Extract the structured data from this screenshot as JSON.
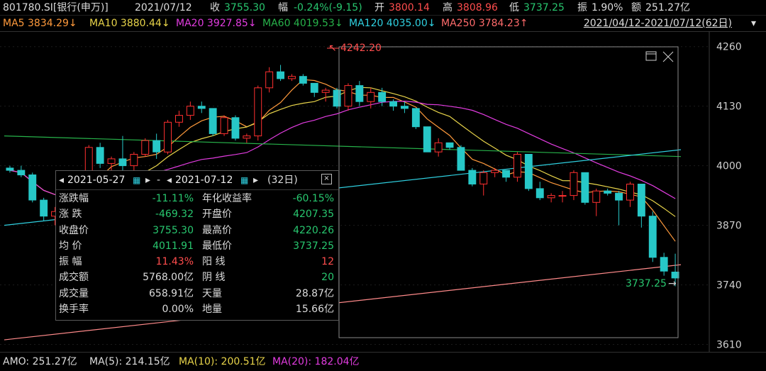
{
  "header": {
    "code": "801780.SI[银行(申万)]",
    "date": "2021/07/12",
    "close_label": "收",
    "close": "3755.30",
    "change_label": "幅",
    "change": "-0.24%(-9.15)",
    "open_label": "开",
    "open": "3800.14",
    "high_label": "高",
    "high": "3808.96",
    "low_label": "低",
    "low": "3737.25",
    "amp_label": "振",
    "amp": "1.90%",
    "amount_label": "额",
    "amount": "251.27亿"
  },
  "ma_bar": {
    "ma5": "MA5 3834.29↓",
    "ma10": "MA10 3880.44↓",
    "ma20": "MA20 3927.85↓",
    "ma60": "MA60 4019.53↓",
    "ma120": "MA120 4035.00↓",
    "ma250": "MA250 3784.23↑",
    "period": "2021/04/12-2021/07/12(62日)"
  },
  "bottom_bar": {
    "amo": "AMO: 251.27亿",
    "ma5": "MA(5): 214.15亿",
    "ma10": "MA(10): 200.51亿",
    "ma20": "MA(20): 182.04亿"
  },
  "popup": {
    "start": "2021-05-27",
    "dash": "-",
    "end": "2021-07-12",
    "days": "(32日)",
    "rows": [
      {
        "l1": "涨跌幅",
        "v1": "-11.11%",
        "l2": "年化收益率",
        "v2": "-60.15%",
        "c1": "g",
        "c2": "g"
      },
      {
        "l1": "涨 跌",
        "v1": "-469.32",
        "l2": "开盘价",
        "v2": "4207.35",
        "c1": "g",
        "c2": "g"
      },
      {
        "l1": "收盘价",
        "v1": "3755.30",
        "l2": "最高价",
        "v2": "4220.26",
        "c1": "g",
        "c2": "g"
      },
      {
        "l1": "均 价",
        "v1": "4011.91",
        "l2": "最低价",
        "v2": "3737.25",
        "c1": "g",
        "c2": "g"
      },
      {
        "l1": "振 幅",
        "v1": "11.43%",
        "l2": "阳 线",
        "v2": "12",
        "c1": "r",
        "c2": "r"
      },
      {
        "l1": "成交额",
        "v1": "5768.00亿",
        "l2": "阴 线",
        "v2": "20",
        "c1": "w",
        "c2": "g"
      },
      {
        "l1": "成交量",
        "v1": "658.91亿",
        "l2": "天量",
        "v2": "28.87亿",
        "c1": "w",
        "c2": "w"
      },
      {
        "l1": "换手率",
        "v1": "0.00%",
        "l2": "地量",
        "v2": "15.66亿",
        "c1": "w",
        "c2": "w"
      }
    ]
  },
  "chart_data": {
    "type": "candlestick",
    "ylim": [
      3600,
      4275
    ],
    "y_ticks": [
      "4260",
      "4130",
      "4000",
      "3870",
      "3740",
      "3610"
    ],
    "annotations": {
      "high": "4242.20",
      "low": "3737.25"
    },
    "candles": [
      [
        3995,
        4000,
        3985,
        3990
      ],
      [
        3990,
        4000,
        3975,
        3980
      ],
      [
        3980,
        3985,
        3920,
        3925
      ],
      [
        3925,
        3930,
        3880,
        3890
      ],
      [
        3890,
        3910,
        3870,
        3900
      ],
      [
        3900,
        3955,
        3895,
        3950
      ],
      [
        3950,
        3985,
        3945,
        3980
      ],
      [
        3980,
        4045,
        3975,
        4040
      ],
      [
        4040,
        4050,
        3995,
        4005
      ],
      [
        4005,
        4020,
        3975,
        4015
      ],
      [
        4015,
        4065,
        3985,
        4000
      ],
      [
        4000,
        4030,
        3990,
        4025
      ],
      [
        4025,
        4060,
        4020,
        4055
      ],
      [
        4055,
        4070,
        4015,
        4030
      ],
      [
        4030,
        4100,
        4025,
        4095
      ],
      [
        4095,
        4120,
        4085,
        4110
      ],
      [
        4110,
        4140,
        4100,
        4130
      ],
      [
        4130,
        4140,
        4115,
        4125
      ],
      [
        4125,
        4125,
        4065,
        4070
      ],
      [
        4070,
        4110,
        4065,
        4105
      ],
      [
        4105,
        4110,
        4055,
        4060
      ],
      [
        4060,
        4070,
        4050,
        4065
      ],
      [
        4065,
        4175,
        4055,
        4170
      ],
      [
        4170,
        4215,
        4160,
        4205
      ],
      [
        4205,
        4220,
        4185,
        4190
      ],
      [
        4190,
        4200,
        4185,
        4195
      ],
      [
        4195,
        4200,
        4175,
        4180
      ],
      [
        4180,
        4180,
        4150,
        4160
      ],
      [
        4160,
        4170,
        4140,
        4165
      ],
      [
        4165,
        4170,
        4125,
        4130
      ],
      [
        4130,
        4180,
        4120,
        4175
      ],
      [
        4175,
        4185,
        4130,
        4140
      ],
      [
        4140,
        4170,
        4125,
        4160
      ],
      [
        4160,
        4170,
        4130,
        4140
      ],
      [
        4140,
        4145,
        4120,
        4130
      ],
      [
        4130,
        4140,
        4115,
        4125
      ],
      [
        4125,
        4125,
        4080,
        4085
      ],
      [
        4085,
        4085,
        4030,
        4030
      ],
      [
        4030,
        4060,
        4020,
        4050
      ],
      [
        4050,
        4050,
        4035,
        4040
      ],
      [
        4040,
        4045,
        3990,
        3990
      ],
      [
        3990,
        3995,
        3955,
        3960
      ],
      [
        3960,
        3990,
        3935,
        3985
      ],
      [
        3985,
        3995,
        3975,
        3990
      ],
      [
        3990,
        3990,
        3965,
        3975
      ],
      [
        3975,
        4030,
        3965,
        4025
      ],
      [
        4025,
        4025,
        3945,
        3950
      ],
      [
        3950,
        3965,
        3925,
        3930
      ],
      [
        3930,
        3940,
        3920,
        3935
      ],
      [
        3935,
        3945,
        3920,
        3935
      ],
      [
        3935,
        3990,
        3925,
        3985
      ],
      [
        3985,
        3985,
        3915,
        3920
      ],
      [
        3920,
        3950,
        3890,
        3945
      ],
      [
        3945,
        3950,
        3935,
        3940
      ],
      [
        3940,
        3945,
        3870,
        3925
      ],
      [
        3925,
        3965,
        3910,
        3960
      ],
      [
        3960,
        3960,
        3865,
        3890
      ],
      [
        3890,
        3900,
        3790,
        3800
      ],
      [
        3800,
        3810,
        3760,
        3770
      ],
      [
        3768,
        3808,
        3737,
        3755
      ]
    ]
  },
  "colors": {
    "up": "#ff3030",
    "down": "#27c8c8",
    "grid": "#3a2020",
    "axis": "#cfcfcf"
  }
}
